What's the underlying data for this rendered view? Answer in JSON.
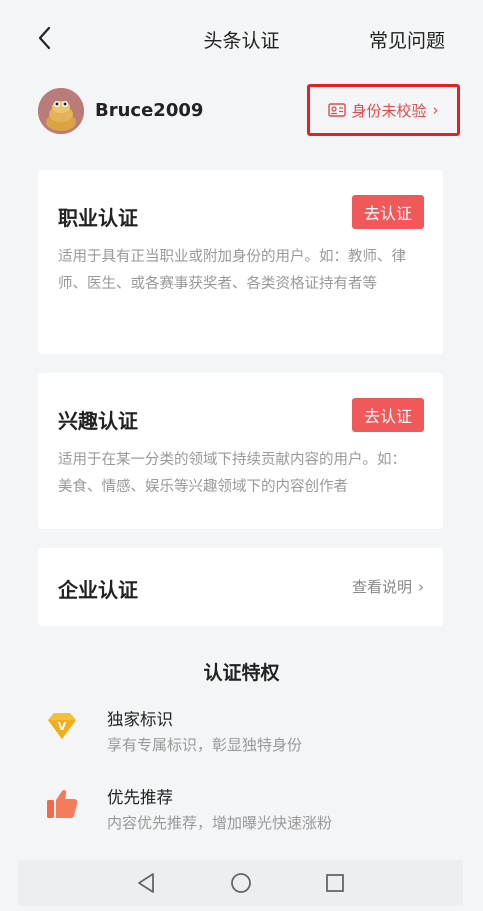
{
  "header": {
    "title": "头条认证",
    "faq": "常见问题"
  },
  "user": {
    "name": "Bruce2009",
    "id_status": "身份未校验",
    "chevron": "›"
  },
  "cards": {
    "professional": {
      "title": "职业认证",
      "button": "去认证",
      "description": "适用于具有正当职业或附加身份的用户。如：教师、律师、医生、或各赛事获奖者、各类资格证持有者等"
    },
    "interest": {
      "title": "兴趣认证",
      "button": "去认证",
      "description": "适用于在某一分类的领域下持续贡献内容的用户。如：美食、情感、娱乐等兴趣领域下的内容创作者"
    },
    "enterprise": {
      "title": "企业认证",
      "link": "查看说明",
      "chevron": "›"
    }
  },
  "privileges": {
    "title": "认证特权",
    "items": [
      {
        "title": "独家标识",
        "description": "享有专属标识，彰显独特身份",
        "icon": "diamond-v-icon"
      },
      {
        "title": "优先推荐",
        "description": "内容优先推荐，增加曝光快速涨粉",
        "icon": "thumbs-up-icon"
      }
    ]
  },
  "colors": {
    "accent": "#f05959",
    "highlight_border": "#e8201d",
    "background": "#f4f5f6",
    "card": "#ffffff",
    "muted_text": "#999999"
  }
}
